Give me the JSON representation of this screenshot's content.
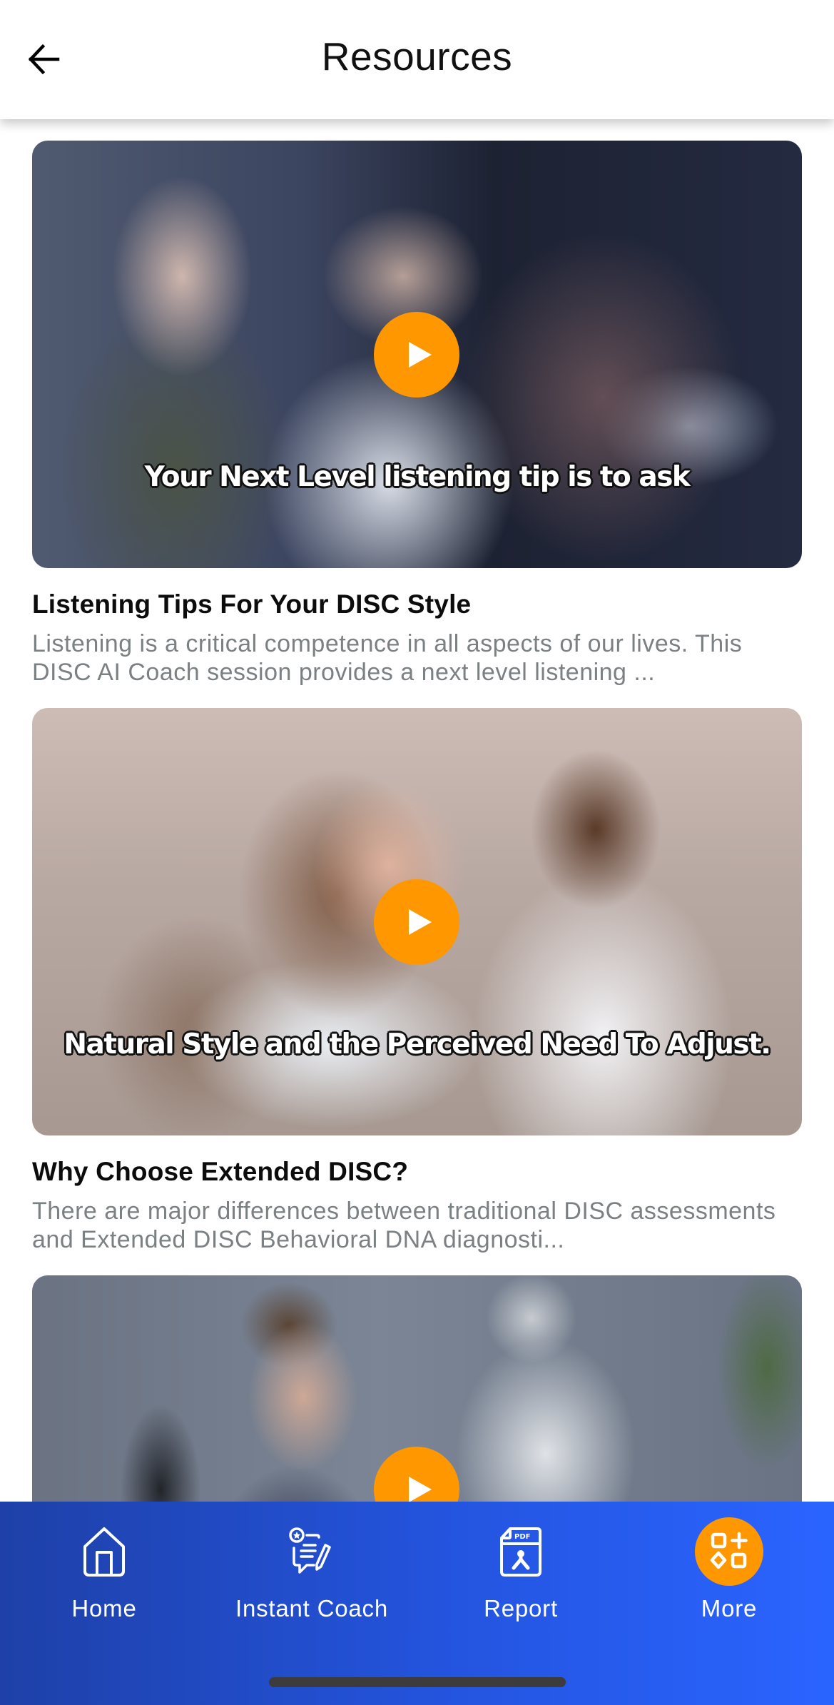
{
  "header": {
    "title": "Resources",
    "back_icon": "arrow-left-icon"
  },
  "resources": [
    {
      "title": "Listening Tips For Your DISC Style",
      "description": "Listening is a critical competence in all aspects of our lives. This DISC AI Coach session provides a next level listening ...",
      "thumbnail_caption": "Your Next Level listening tip is to ask",
      "play_icon": "play-icon"
    },
    {
      "title": "Why Choose Extended DISC?",
      "description": "There are major differences between traditional DISC assessments and Extended DISC Behavioral DNA diagnosti...",
      "thumbnail_caption": "Natural Style and the Perceived Need To Adjust.",
      "play_icon": "play-icon"
    },
    {
      "title": "",
      "description": "",
      "thumbnail_caption": "",
      "play_icon": "play-icon"
    }
  ],
  "bottom_nav": {
    "items": [
      {
        "label": "Home",
        "icon": "home-icon",
        "active": false
      },
      {
        "label": "Instant Coach",
        "icon": "coach-chat-icon",
        "active": false
      },
      {
        "label": "Report",
        "icon": "pdf-report-icon",
        "active": false
      },
      {
        "label": "More",
        "icon": "more-apps-icon",
        "active": true
      }
    ]
  },
  "colors": {
    "accent": "#ff9800",
    "nav_gradient_start": "#1e40a8",
    "nav_gradient_end": "#2a64ff",
    "title_text": "#0c0c0c",
    "description_text": "#7b8083"
  }
}
